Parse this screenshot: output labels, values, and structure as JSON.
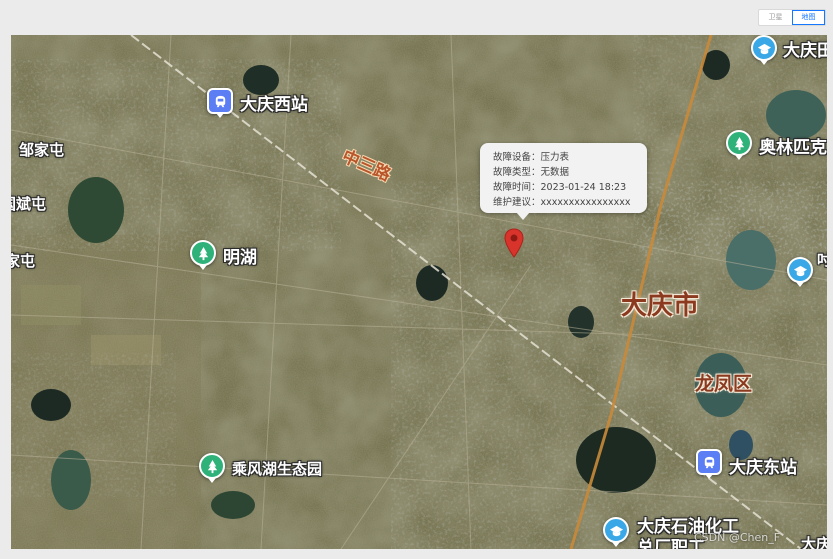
{
  "map_type_toggle": {
    "options": [
      "卫星",
      "地图"
    ],
    "active": "地图"
  },
  "map": {
    "labels": {
      "daqing_west_station": "大庆西站",
      "zoujiatun": "邹家屯",
      "guobintun": "国斌屯",
      "jiatun": "家屯",
      "minghu": "明湖",
      "zhongsan_road": "中三路",
      "daqing_city": "大庆市",
      "longfeng_district": "龙凤区",
      "chengfenghu_park": "乘风湖生态园",
      "daqing_east_station": "大庆东站",
      "petrochem_school_line1": "大庆石油化工",
      "petrochem_school_line2": "总厂职工",
      "top_right_partial": "大庆田",
      "olympic_partial": "奥林匹克",
      "right_edge_partial": "吋",
      "bottom_right_partial": "大庆"
    },
    "poi_icons": {
      "station": "train-station-icon",
      "park": "park-tree-icon",
      "school": "school-cap-icon"
    }
  },
  "info_window": {
    "rows": [
      {
        "label": "故障设备：",
        "value": "压力表"
      },
      {
        "label": "故障类型：",
        "value": "无数据"
      },
      {
        "label": "故障时间：",
        "value": "2023-01-24 18:23"
      },
      {
        "label": "维护建议：",
        "value": "xxxxxxxxxxxxxxxx"
      }
    ]
  },
  "marker": {
    "icon": "map-pin-icon",
    "color": "#d9342b"
  },
  "watermark": "CSDN @Chen_F",
  "colors": {
    "accent": "#1677ff",
    "station_poi": "#5b7ef5",
    "park_poi": "#2fb17a",
    "school_poi": "#3aa8e6",
    "city_label": "#8b3a1f",
    "road_label": "#b8552a"
  }
}
